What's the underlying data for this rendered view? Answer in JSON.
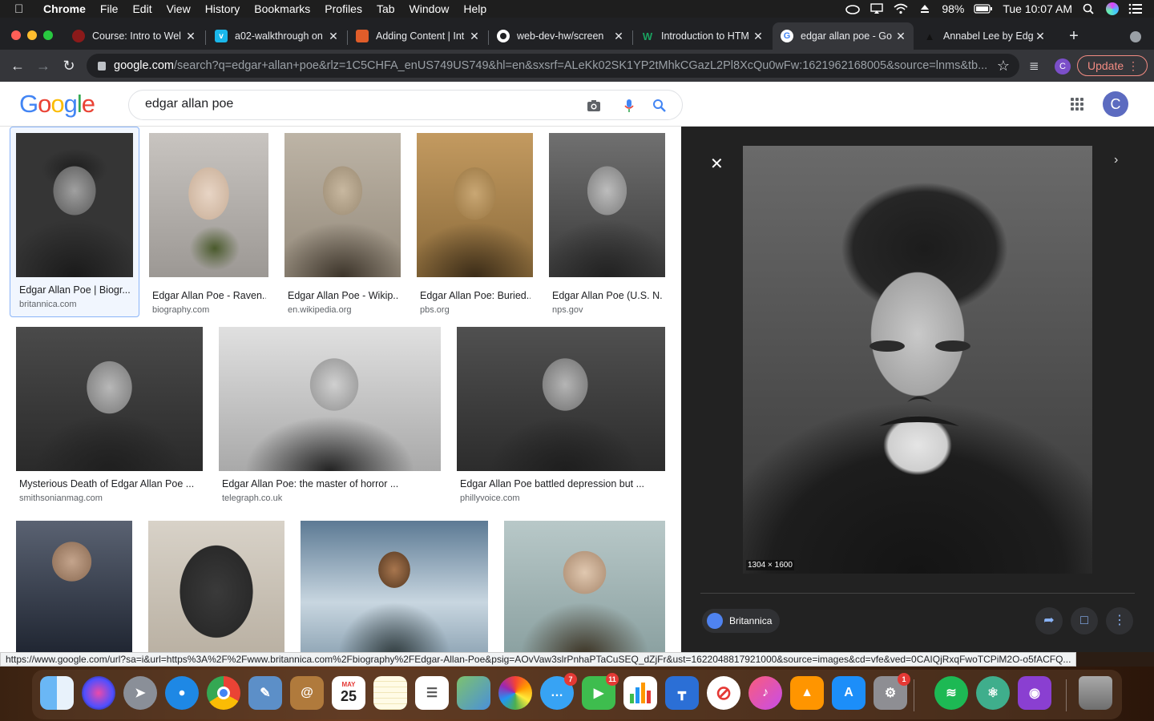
{
  "menubar": {
    "app": "Chrome",
    "items": [
      "File",
      "Edit",
      "View",
      "History",
      "Bookmarks",
      "Profiles",
      "Tab",
      "Window",
      "Help"
    ],
    "battery": "98%",
    "clock": "Tue 10:07 AM"
  },
  "tabs": [
    {
      "title": "Course: Intro to Wel",
      "icon": "course-icon",
      "color": "#8b1a1a"
    },
    {
      "title": "a02-walkthrough on",
      "icon": "vimeo-icon",
      "color": "#1ab7ea"
    },
    {
      "title": "Adding Content | Int",
      "icon": "codecademy-icon",
      "color": "#e05d2a"
    },
    {
      "title": "web-dev-hw/screen",
      "icon": "github-icon",
      "color": "#ffffff"
    },
    {
      "title": "Introduction to HTM",
      "icon": "w-icon",
      "color": "#1aa260"
    },
    {
      "title": "edgar allan poe - Go",
      "icon": "google-icon",
      "color": "#ffffff"
    },
    {
      "title": "Annabel Lee by Edg",
      "icon": "raven-icon",
      "color": "#222222"
    }
  ],
  "toolbar": {
    "url_domain": "google.com",
    "url_rest": "/search?q=edgar+allan+poe&rlz=1C5CHFA_enUS749US749&hl=en&sxsrf=ALeKk02SK1YP2tMhkCGazL2Pl8XcQu0wFw:1621962168005&source=lnms&tb...",
    "profile_initial": "C",
    "update_label": "Update"
  },
  "search": {
    "query": "edgar allan poe",
    "avatar_initial": "C"
  },
  "results": [
    {
      "title": "Edgar Allan Poe | Biogr...",
      "source": "britannica.com",
      "selected": true
    },
    {
      "title": "Edgar Allan Poe - Raven...",
      "source": "biography.com"
    },
    {
      "title": "Edgar Allan Poe - Wikip...",
      "source": "en.wikipedia.org"
    },
    {
      "title": "Edgar Allan Poe: Buried...",
      "source": "pbs.org"
    },
    {
      "title": "Edgar Allan Poe (U.S. N...",
      "source": "nps.gov"
    },
    {
      "title": "Mysterious Death of Edgar Allan Poe ...",
      "source": "smithsonianmag.com"
    },
    {
      "title": "Edgar Allan Poe: the master of horror ...",
      "source": "telegraph.co.uk"
    },
    {
      "title": "Edgar Allan Poe battled depression but ...",
      "source": "phillyvoice.com"
    }
  ],
  "preview": {
    "dimensions": "1304 × 1600",
    "source_name": "Britannica"
  },
  "statusbar": {
    "url": "https://www.google.com/url?sa=i&url=https%3A%2F%2Fwww.britannica.com%2Fbiography%2FEdgar-Allan-Poe&psig=AOvVaw3slrPnhaPTaCuSEQ_dZjFr&ust=1622048817921000&source=images&cd=vfe&ved=0CAIQjRxqFwoTCPiM2O-o5fACFQ..."
  },
  "dock": {
    "calendar_month": "MAY",
    "calendar_day": "25",
    "facetime_badge": "7",
    "messages_badge": "11",
    "settings_badge": "1"
  },
  "colors": {
    "google_blue": "#4285f4",
    "google_red": "#ea4335",
    "google_yellow": "#fbbc05",
    "google_green": "#34a853",
    "update_red": "#f28b82"
  }
}
